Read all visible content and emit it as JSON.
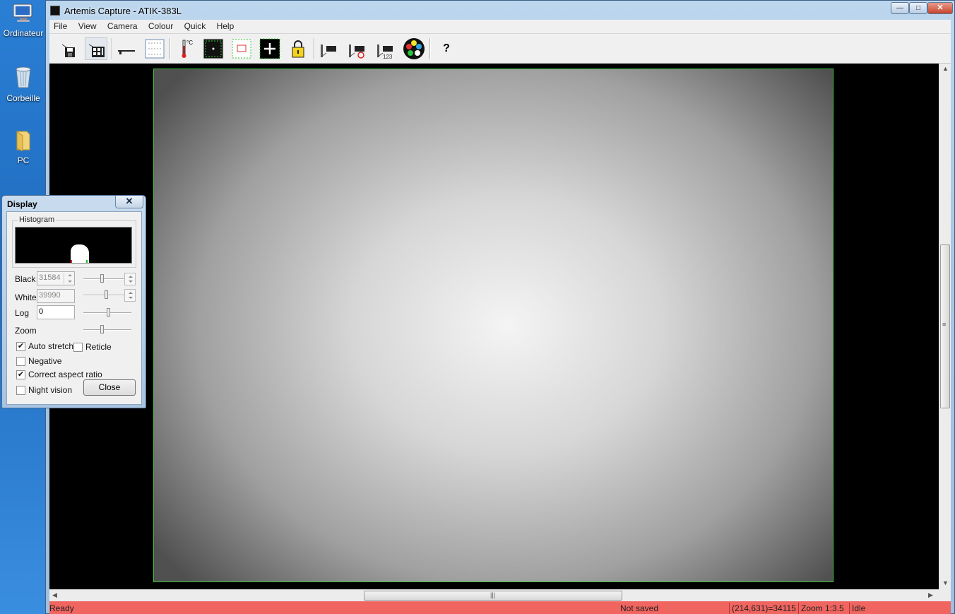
{
  "desktop": {
    "icons": [
      {
        "label": "Ordinateur",
        "icon": "computer-icon"
      },
      {
        "label": "Corbeille",
        "icon": "recycle-bin-icon"
      },
      {
        "label": "PC",
        "icon": "folder-icon"
      }
    ]
  },
  "window": {
    "title": "Artemis Capture - ATIK-383L",
    "controls": {
      "minimize": "—",
      "maximize": "□",
      "close": "✕"
    }
  },
  "menu": [
    "File",
    "View",
    "Camera",
    "Colour",
    "Quick",
    "Help"
  ],
  "toolbar": {
    "buttons": [
      {
        "icon": "save-icon",
        "pressed": false
      },
      {
        "icon": "film-capture-icon",
        "pressed": true
      },
      {
        "icon": "focus-bar-icon",
        "pressed": false
      },
      {
        "icon": "display-settings-icon",
        "pressed": false
      },
      {
        "icon": "thermometer-icon",
        "pressed": false,
        "text": "°C"
      },
      {
        "icon": "crosshair-icon",
        "pressed": false
      },
      {
        "icon": "subframe-icon",
        "pressed": false
      },
      {
        "icon": "reticle-plus-icon",
        "pressed": false
      },
      {
        "icon": "lock-icon",
        "pressed": false
      },
      {
        "icon": "single-exposure-icon",
        "pressed": false
      },
      {
        "icon": "continuous-exposure-icon",
        "pressed": false
      },
      {
        "icon": "sequence-exposure-icon",
        "pressed": false,
        "text": "123"
      },
      {
        "icon": "colour-filter-wheel-icon",
        "pressed": false
      },
      {
        "icon": "help-icon",
        "pressed": false,
        "text": "?"
      }
    ]
  },
  "status": {
    "ready": "Ready",
    "saved": "Not saved",
    "pixel": "(214,631)=34115",
    "zoom": "Zoom 1:3.5",
    "state": "Idle",
    "color": "#f0655f"
  },
  "display_dialog": {
    "title": "Display",
    "close": "✕",
    "histogram_label": "Histogram",
    "black": {
      "label": "Black",
      "value": "31584"
    },
    "white": {
      "label": "White",
      "value": "39990"
    },
    "log": {
      "label": "Log",
      "value": "0"
    },
    "zoom": {
      "label": "Zoom"
    },
    "sliders": {
      "black_level": 0.38,
      "white_level": 0.48,
      "log_level": 0.52,
      "zoom_level": 0.38
    },
    "checkboxes": {
      "auto_stretch": {
        "label": "Auto stretch",
        "checked": true
      },
      "reticle": {
        "label": "Reticle",
        "checked": false
      },
      "negative": {
        "label": "Negative",
        "checked": false
      },
      "correct_aspect": {
        "label": "Correct aspect ratio",
        "checked": true
      },
      "night_vision": {
        "label": "Night vision",
        "checked": false
      }
    },
    "close_button": "Close"
  },
  "image": {
    "border_color": "#3cc43c"
  }
}
